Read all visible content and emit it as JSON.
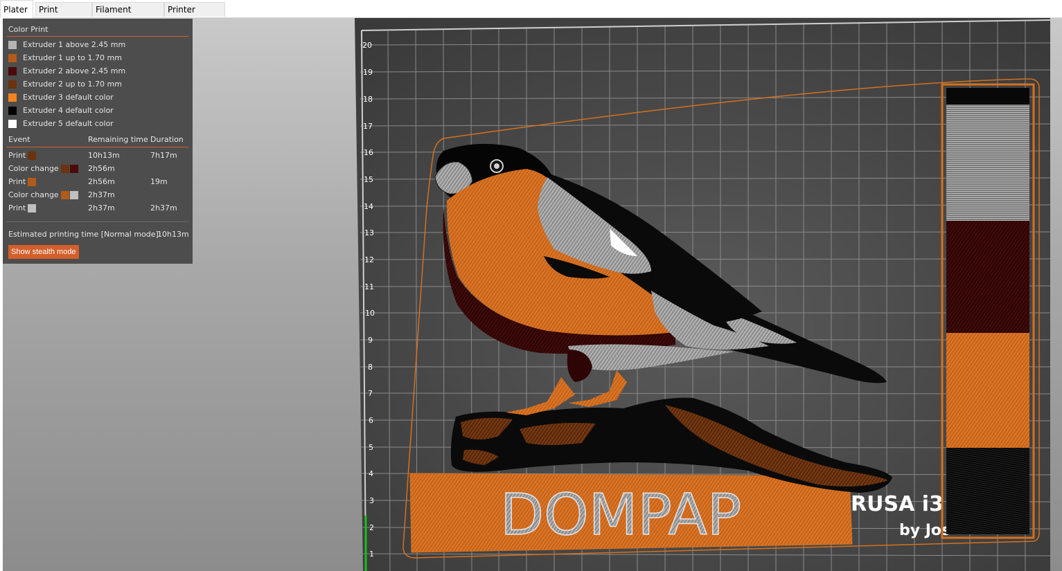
{
  "tabs": [
    "Plater",
    "Print Settings",
    "Filament Settings",
    "Printer Settings"
  ],
  "panel": {
    "title": "Color Print",
    "legend": [
      {
        "label": "Extruder 1 above 2.45 mm",
        "color": "#b4b4b4"
      },
      {
        "label": "Extruder 1 up to 1.70 mm",
        "color": "#b35a1a"
      },
      {
        "label": "Extruder 2 above 2.45 mm",
        "color": "#4a0a0a"
      },
      {
        "label": "Extruder 2 up to 1.70 mm",
        "color": "#6b3310"
      },
      {
        "label": "Extruder 3 default color",
        "color": "#f5841f"
      },
      {
        "label": "Extruder 4 default color",
        "color": "#000000"
      },
      {
        "label": "Extruder 5 default color",
        "color": "#ffffff"
      }
    ],
    "columns": {
      "event": "Event",
      "remaining": "Remaining time",
      "duration": "Duration"
    },
    "events": [
      {
        "event": "Print",
        "colors": [
          "#6b3310"
        ],
        "remaining": "10h13m",
        "duration": "7h17m"
      },
      {
        "event": "Color change",
        "colors": [
          "#6b3310",
          "#4a0a0a"
        ],
        "remaining": "2h56m",
        "duration": ""
      },
      {
        "event": "Print",
        "colors": [
          "#b35a1a"
        ],
        "remaining": "2h56m",
        "duration": "19m"
      },
      {
        "event": "Color change",
        "colors": [
          "#b35a1a",
          "#c0c0c0"
        ],
        "remaining": "2h37m",
        "duration": ""
      },
      {
        "event": "Print",
        "colors": [
          "#c0c0c0"
        ],
        "remaining": "2h37m",
        "duration": "2h37m"
      }
    ],
    "estimate_label": "Estimated printing time [Normal mode]:",
    "estimate_value": "10h13m",
    "stealth_button": "Show stealth mode"
  },
  "scene": {
    "bed_label_a": "RUSA i3",
    "bed_label_b": "by Jos",
    "model_text": "DOMPAP",
    "axis_ticks": [
      "1",
      "2",
      "3",
      "4",
      "5",
      "6",
      "7",
      "8",
      "9",
      "10",
      "11",
      "12",
      "13",
      "14",
      "15",
      "16",
      "17",
      "18",
      "19",
      "20"
    ]
  },
  "colors": {
    "accent": "#d35f2a",
    "panel_bg": "#4d4d4d",
    "bed": "#4a4a4a"
  }
}
